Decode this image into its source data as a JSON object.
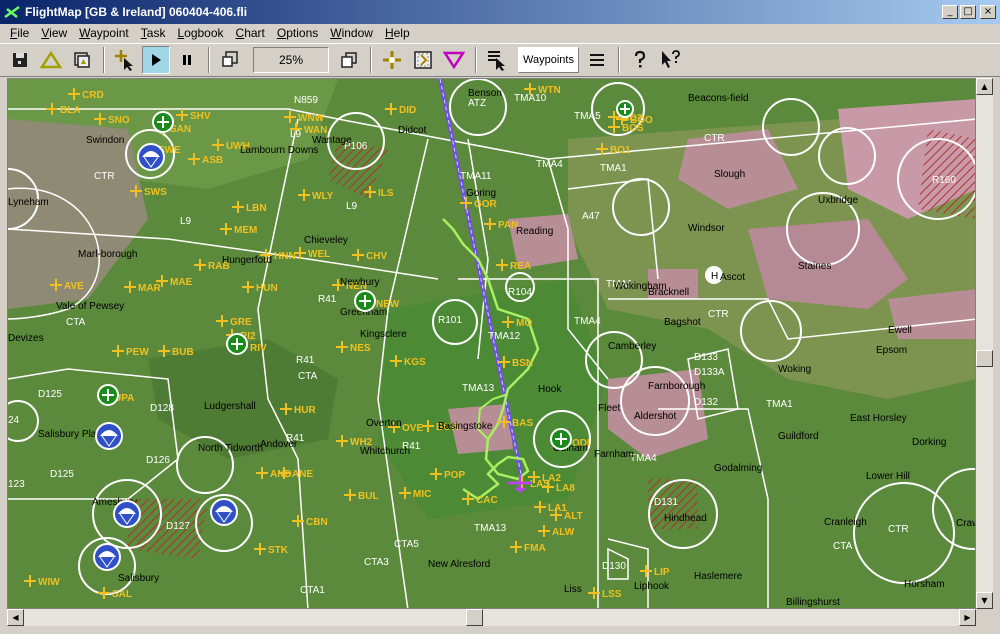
{
  "window": {
    "title": "FlightMap  [GB & Ireland]  060404-406.fli"
  },
  "window_controls": {
    "minimize": "_",
    "maximize": "□",
    "close": "×"
  },
  "menu": [
    {
      "u": "F",
      "rest": "ile"
    },
    {
      "u": "V",
      "rest": "iew"
    },
    {
      "u": "W",
      "rest": "aypoint"
    },
    {
      "u": "T",
      "rest": "ask"
    },
    {
      "u": "L",
      "rest": "ogbook"
    },
    {
      "u": "C",
      "rest": "hart"
    },
    {
      "u": "O",
      "rest": "ptions"
    },
    {
      "u": "W",
      "rest": "indow"
    },
    {
      "u": "H",
      "rest": "elp"
    }
  ],
  "toolbar": {
    "zoom": "25%",
    "waypoints_label": "Waypoints"
  },
  "colors": {
    "airspace": "#ffffff",
    "waypoint": "#f0c020",
    "track": "#a8f060",
    "task_line": "#7050e0",
    "terrain": "#5b8a3c",
    "urban": "#c89aa8"
  },
  "map": {
    "waypoints": [
      {
        "name": "CRD"
      },
      {
        "name": "BLA"
      },
      {
        "name": "SNO"
      },
      {
        "name": "SAN"
      },
      {
        "name": "SHV"
      },
      {
        "name": "SWE"
      },
      {
        "name": "UWH"
      },
      {
        "name": "ASB"
      },
      {
        "name": "SWS"
      },
      {
        "name": "LBN"
      },
      {
        "name": "MEM"
      },
      {
        "name": "RAB"
      },
      {
        "name": "MAE"
      },
      {
        "name": "MAR"
      },
      {
        "name": "AVE"
      },
      {
        "name": "HUN"
      },
      {
        "name": "HNN"
      },
      {
        "name": "WEL"
      },
      {
        "name": "CHV"
      },
      {
        "name": "NEN"
      },
      {
        "name": "NEW"
      },
      {
        "name": "GRE"
      },
      {
        "name": "RIV"
      },
      {
        "name": "RI2"
      },
      {
        "name": "PEW"
      },
      {
        "name": "BUB"
      },
      {
        "name": "NES"
      },
      {
        "name": "KGS"
      },
      {
        "name": "DID"
      },
      {
        "name": "WNW"
      },
      {
        "name": "WAN"
      },
      {
        "name": "WLY"
      },
      {
        "name": "ILS"
      },
      {
        "name": "GOR"
      },
      {
        "name": "PAN"
      },
      {
        "name": "REA"
      },
      {
        "name": "MO"
      },
      {
        "name": "BSN"
      },
      {
        "name": "UPA"
      },
      {
        "name": "HUR"
      },
      {
        "name": "WH2"
      },
      {
        "name": "OVE"
      },
      {
        "name": "BCW"
      },
      {
        "name": "BAS"
      },
      {
        "name": "ODI"
      },
      {
        "name": "AND"
      },
      {
        "name": "ANE"
      },
      {
        "name": "POP"
      },
      {
        "name": "BUL"
      },
      {
        "name": "MIC"
      },
      {
        "name": "CAC"
      },
      {
        "name": "LA2"
      },
      {
        "name": "LAS"
      },
      {
        "name": "LA8"
      },
      {
        "name": "LA1"
      },
      {
        "name": "ALT"
      },
      {
        "name": "ALW"
      },
      {
        "name": "CBN"
      },
      {
        "name": "STK"
      },
      {
        "name": "FMA"
      },
      {
        "name": "WIW"
      },
      {
        "name": "SAL"
      },
      {
        "name": "LIP"
      },
      {
        "name": "LSS"
      },
      {
        "name": "WTN"
      },
      {
        "name": "BO1"
      },
      {
        "name": "BOS"
      },
      {
        "name": "BOO"
      },
      {
        "name": "BO2"
      }
    ],
    "airspace": [
      "TMA10",
      "TMA5",
      "TMA4",
      "TMA11",
      "TMA1",
      "TMA12",
      "TMA13",
      "TMA4",
      "TMA1",
      "TMA4",
      "TMA1",
      "TMA13",
      "CTR",
      "CTR",
      "CTR",
      "CTR",
      "CTA",
      "CTA",
      "CTA",
      "R41",
      "R41",
      "R41",
      "R41",
      "L9",
      "L9",
      "L9",
      "D125",
      "D125",
      "D126",
      "D127",
      "D128",
      "D131",
      "D132",
      "D133",
      "D133A",
      "D130",
      "P106",
      "R101",
      "R104",
      "R160",
      "ATZ",
      "CTA5",
      "CTA3",
      "CTA1",
      "N859",
      "A47",
      "24",
      "123"
    ],
    "towns": [
      "Swindon",
      "Lambourn Downs",
      "Marl-borough",
      "Vale of Pewsey",
      "Didcot",
      "Wantage",
      "Goring",
      "Reading",
      "Slough",
      "Uxbridge",
      "Windsor",
      "Staines",
      "Ascot",
      "Bracknell",
      "Newbury",
      "Greenham",
      "Kingsclere",
      "Basingstoke",
      "Hook",
      "Fleet",
      "Farnborough",
      "Aldershot",
      "Camberley",
      "Woking",
      "Epsom",
      "Guildford",
      "East Horsley",
      "Dorking",
      "Godalming",
      "Haslemere",
      "Liphook",
      "Liss",
      "Andover",
      "Whitchurch",
      "Salisbury Plain",
      "Amesbury",
      "Salisbury",
      "Ludgershall",
      "North Tidworth",
      "New Alresford",
      "Cranleigh",
      "Horsham",
      "Crawley",
      "Billingshurst",
      "Beacons-field",
      "Chieveley",
      "Benson",
      "Overton",
      "Odiham",
      "Farnham",
      "Devizes",
      "Lyneham",
      "Ewell",
      "Hindhead",
      "Bagshot",
      "Hungerford",
      "Wokingham",
      "Lower Hill"
    ]
  }
}
